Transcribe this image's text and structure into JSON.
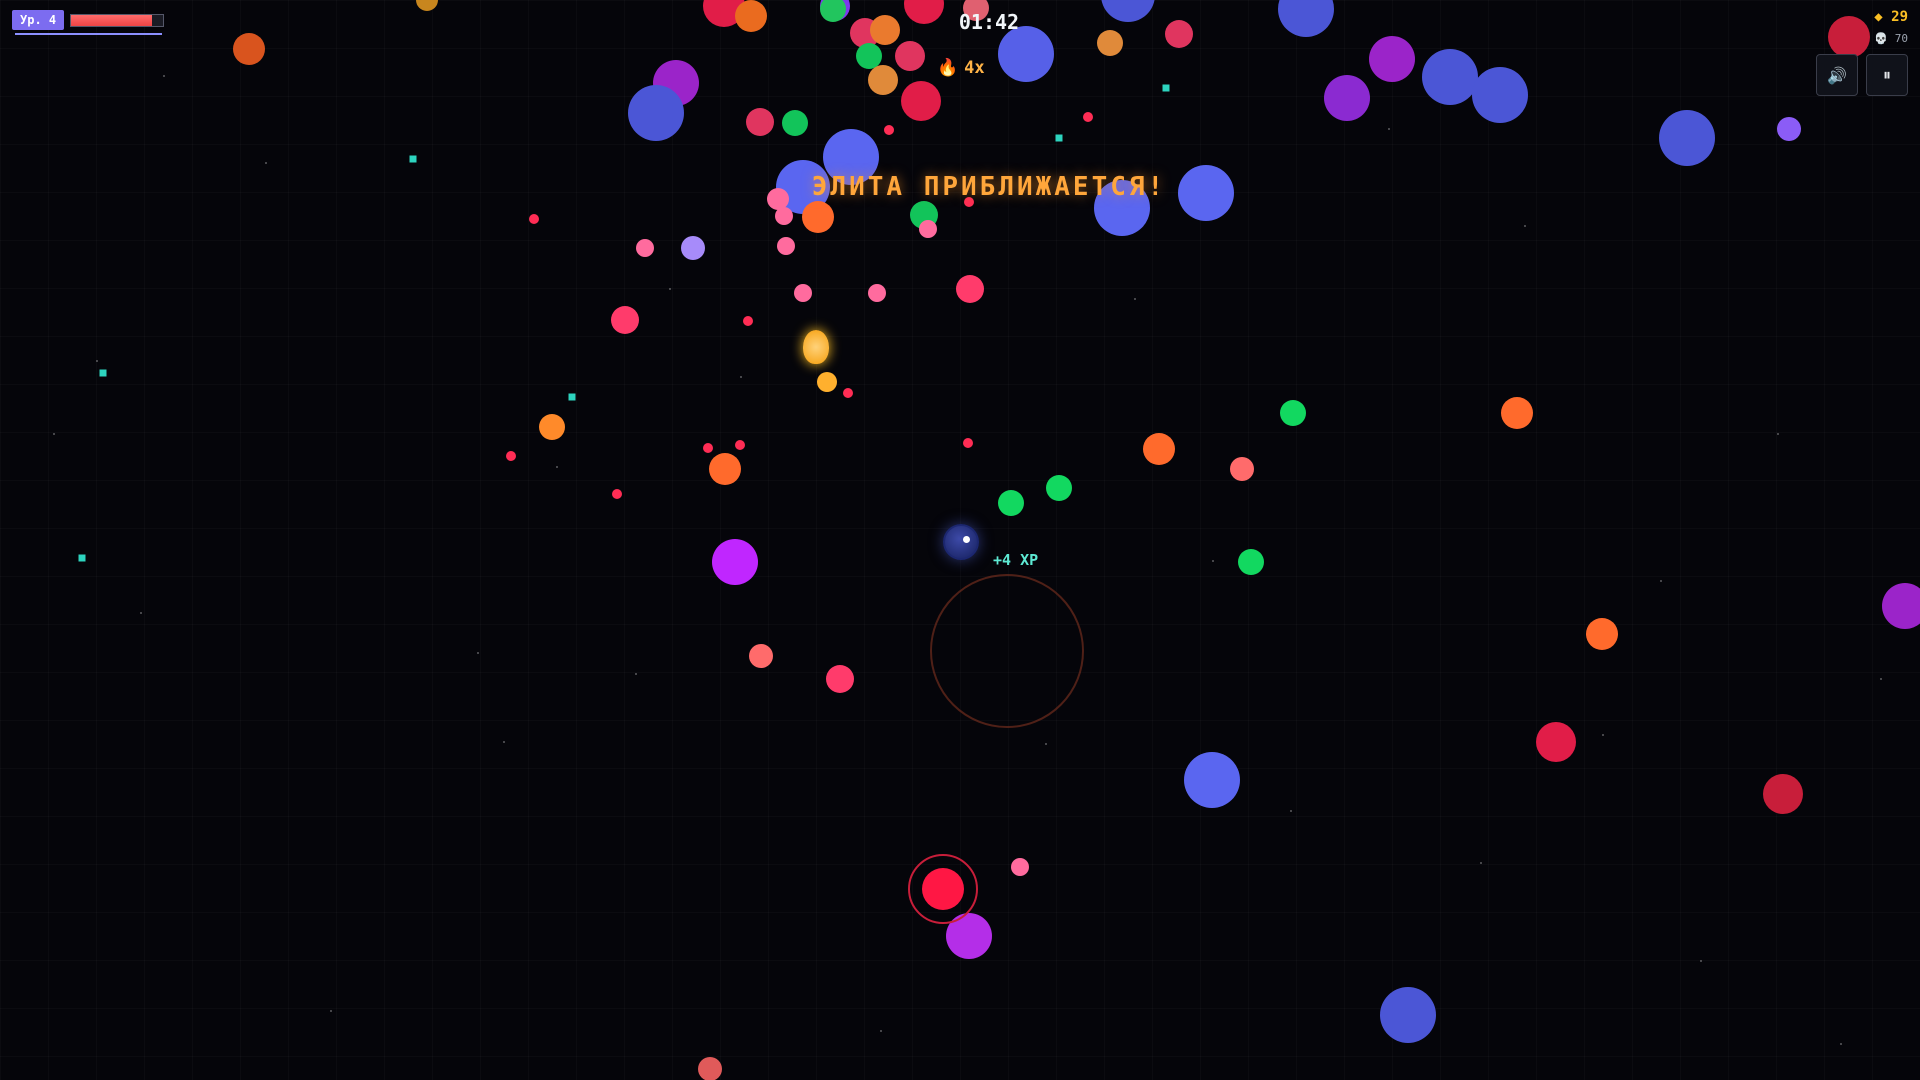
{
  "hud": {
    "level_label": "Ур. 4",
    "health_fraction": 0.88,
    "xp_fraction": 1.0,
    "timer": "01:42",
    "combo": "4x",
    "banner": "ЭЛИТА ПРИБЛИЖАЕТСЯ!",
    "gold": "29",
    "gold_icon": "◆",
    "kills": "70",
    "kills_icon": "💀",
    "xp_popup": "+4 XP"
  },
  "controls": {
    "sound_icon": "🔊",
    "pause_icon": "⏸"
  },
  "colors": {
    "accent": "#7c6cf0",
    "health": "#ef4444",
    "banner": "#ffa63b",
    "gold": "#fbbf24",
    "xp_text": "#5eead4"
  }
}
